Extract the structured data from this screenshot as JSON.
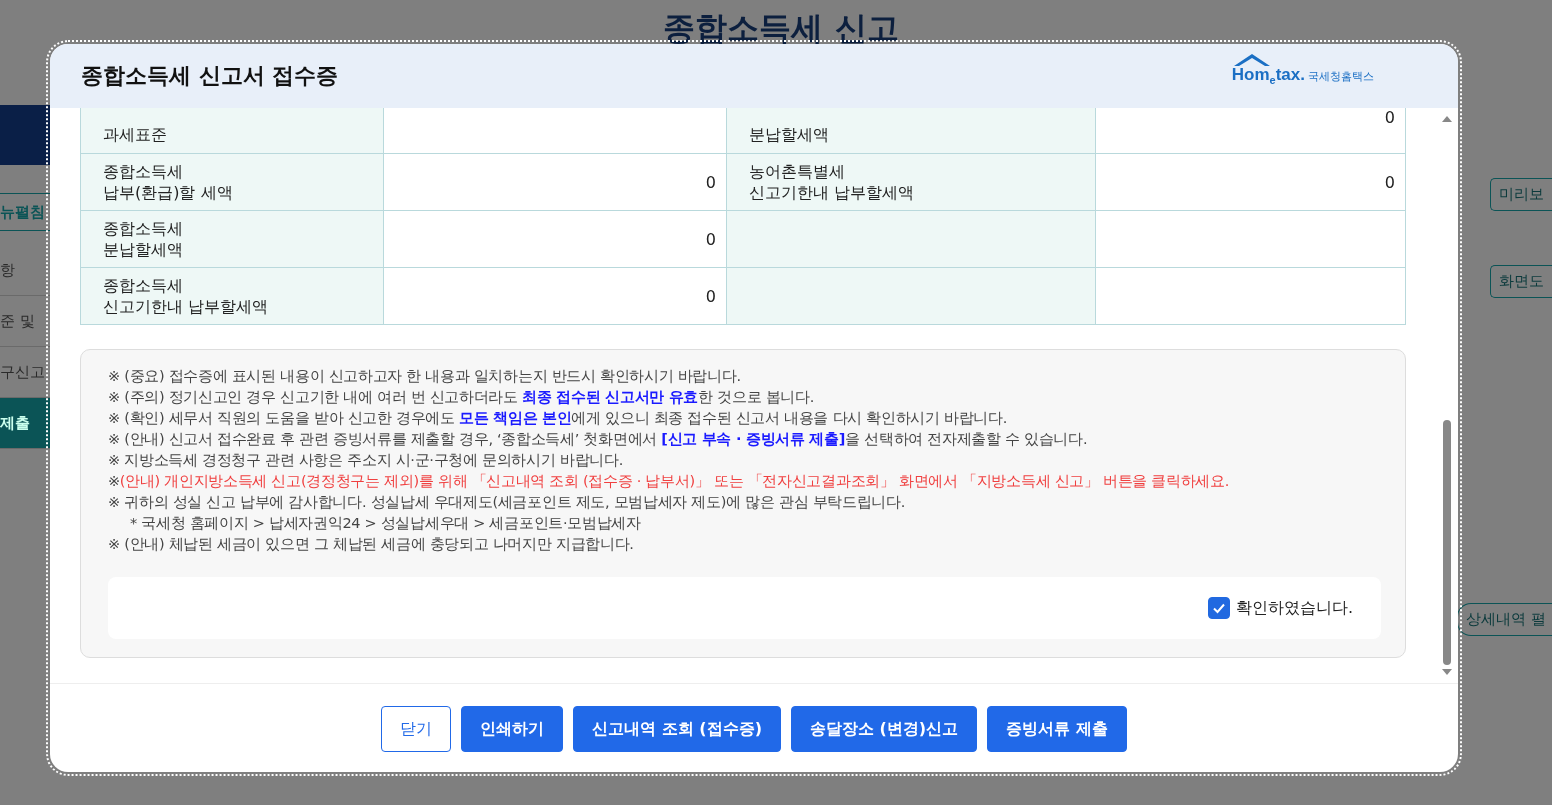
{
  "background_page": {
    "title": "종합소득세 신고",
    "sidebar_items": [
      {
        "label": "뉴펼침",
        "selected": false
      },
      {
        "label": "항",
        "selected": false
      },
      {
        "label": "준 및",
        "selected": false
      },
      {
        "label": "구신고",
        "selected": false
      },
      {
        "label": "제출",
        "selected": true
      }
    ],
    "side_buttons": [
      "미리보",
      "화면도",
      "상세내역 펼"
    ]
  },
  "dialog": {
    "title": "종합소득세 신고서 접수증",
    "logo": {
      "brand": "Hom$_{e}$tax.",
      "org": "국세청홈택스"
    },
    "table_rows": [
      {
        "cells": [
          {
            "label": "과세표준"
          },
          {
            "label": "분납할세액",
            "value": "0"
          }
        ]
      },
      {
        "cells": [
          {
            "label": "종합소득세\n납부(환급)할 세액",
            "value": "0"
          },
          {
            "label": "농어촌특별세\n신고기한내 납부할세액",
            "value": "0"
          }
        ]
      },
      {
        "cells": [
          {
            "label": "종합소득세\n분납할세액",
            "value": "0"
          },
          {}
        ]
      },
      {
        "cells": [
          {
            "label": "종합소득세\n신고기한내 납부할세액",
            "value": "0"
          },
          {}
        ]
      }
    ],
    "notices": [
      {
        "kind": "normal",
        "text": "※ (중요) 접수증에 표시된 내용이 신고하고자 한 내용과 일치하는지 반드시 확인하시기 바랍니다."
      },
      {
        "kind": "normal",
        "text": "※ (주의) 정기신고인 경우 신고기한 내에 여러 번 신고하더라도 **최종 접수된 신고서만 유효**한 것으로 봅니다."
      },
      {
        "kind": "normal",
        "text": "※ (확인) 세무서 직원의 도움을 받아 신고한 경우에도 **모든 책임은 본인**에게 있으니 최종 접수된 신고서 내용을 다시 확인하시기 바랍니다."
      },
      {
        "kind": "normal",
        "text": "※ (안내) 신고서 접수완료 후 관련 증빙서류를 제출할 경우, ‘종합소득세’ 첫화면에서 **[신고 부속  ·  증빙서류 제출]**을 선택하여 전자제출할 수 있습니다."
      },
      {
        "kind": "normal",
        "text": "※ 지방소득세 경정청구 관련 사항은 주소지 시·군·구청에 문의하시기 바랍니다."
      },
      {
        "kind": "warning",
        "mark": "※",
        "text": "(안내) 개인지방소득세 신고(경정청구는 제외)를 위해 「신고내역 조회 (접수증 · 납부서)」 또는 「전자신고결과조회」 화면에서 「지방소득세 신고」 버튼을 클릭하세요."
      },
      {
        "kind": "normal",
        "text": "※ 귀하의 성실 신고 납부에 감사합니다. 성실납세 우대제도(세금포인트 제도, 모범납세자 제도)에 많은 관심 부탁드립니다."
      },
      {
        "kind": "sub",
        "text": "* 국세청 홈페이지 > 납세자권익24 > 성실납세우대 > 세금포인트·모범납세자"
      },
      {
        "kind": "normal",
        "text": "※ (안내) 체납된 세금이 있으면 그 체납된 세금에 충당되고 나머지만 지급합니다."
      }
    ],
    "confirm": {
      "label": "확인하였습니다.",
      "checked": true
    },
    "buttons": [
      {
        "label": "닫기",
        "kind": "outline"
      },
      {
        "label": "인쇄하기",
        "kind": "primary"
      },
      {
        "label": "신고내역 조회 (접수증)",
        "kind": "primary"
      },
      {
        "label": "송달장소 (변경)신고",
        "kind": "primary"
      },
      {
        "label": "증빙서류 제출",
        "kind": "primary"
      }
    ]
  }
}
